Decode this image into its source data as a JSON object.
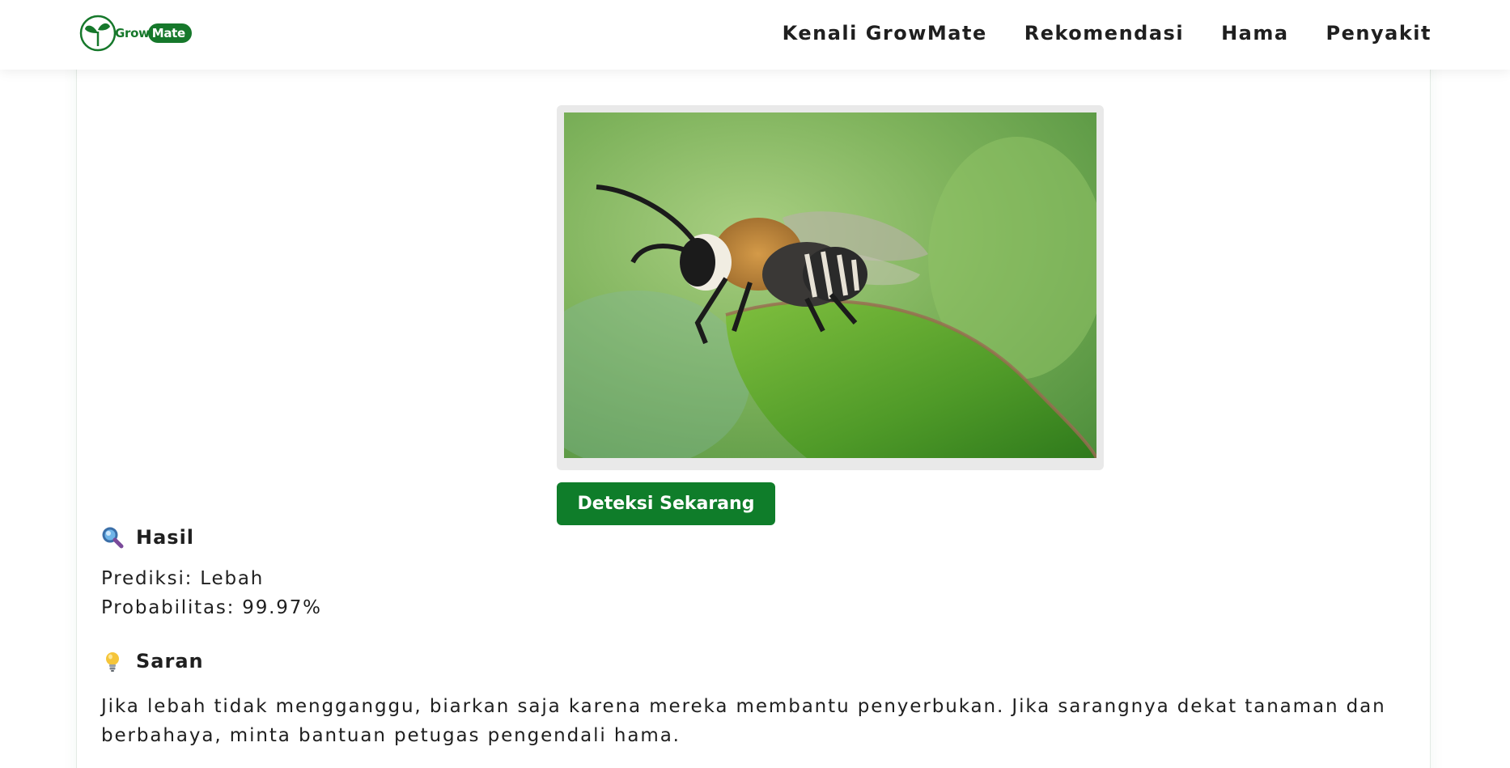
{
  "brand": {
    "grow": "Grow",
    "mate": "Mate",
    "color": "#16782b"
  },
  "nav": {
    "items": [
      {
        "label": "Kenali GrowMate"
      },
      {
        "label": "Rekomendasi"
      },
      {
        "label": "Hama"
      },
      {
        "label": "Penyakit"
      }
    ]
  },
  "preview": {
    "icon": "uploaded-image-bee"
  },
  "detect": {
    "label": "Deteksi Sekarang",
    "color": "#0f7d2a"
  },
  "result": {
    "heading": "Hasil",
    "heading_icon": "magnifier-icon",
    "prediction": "Prediksi: Lebah",
    "probability": "Probabilitas: 99.97%"
  },
  "advice": {
    "heading": "Saran",
    "heading_icon": "lightbulb-icon",
    "text": "Jika lebah tidak mengganggu, biarkan saja karena mereka membantu penyerbukan. Jika sarangnya dekat tanaman dan berbahaya, minta bantuan petugas pengendali hama."
  }
}
